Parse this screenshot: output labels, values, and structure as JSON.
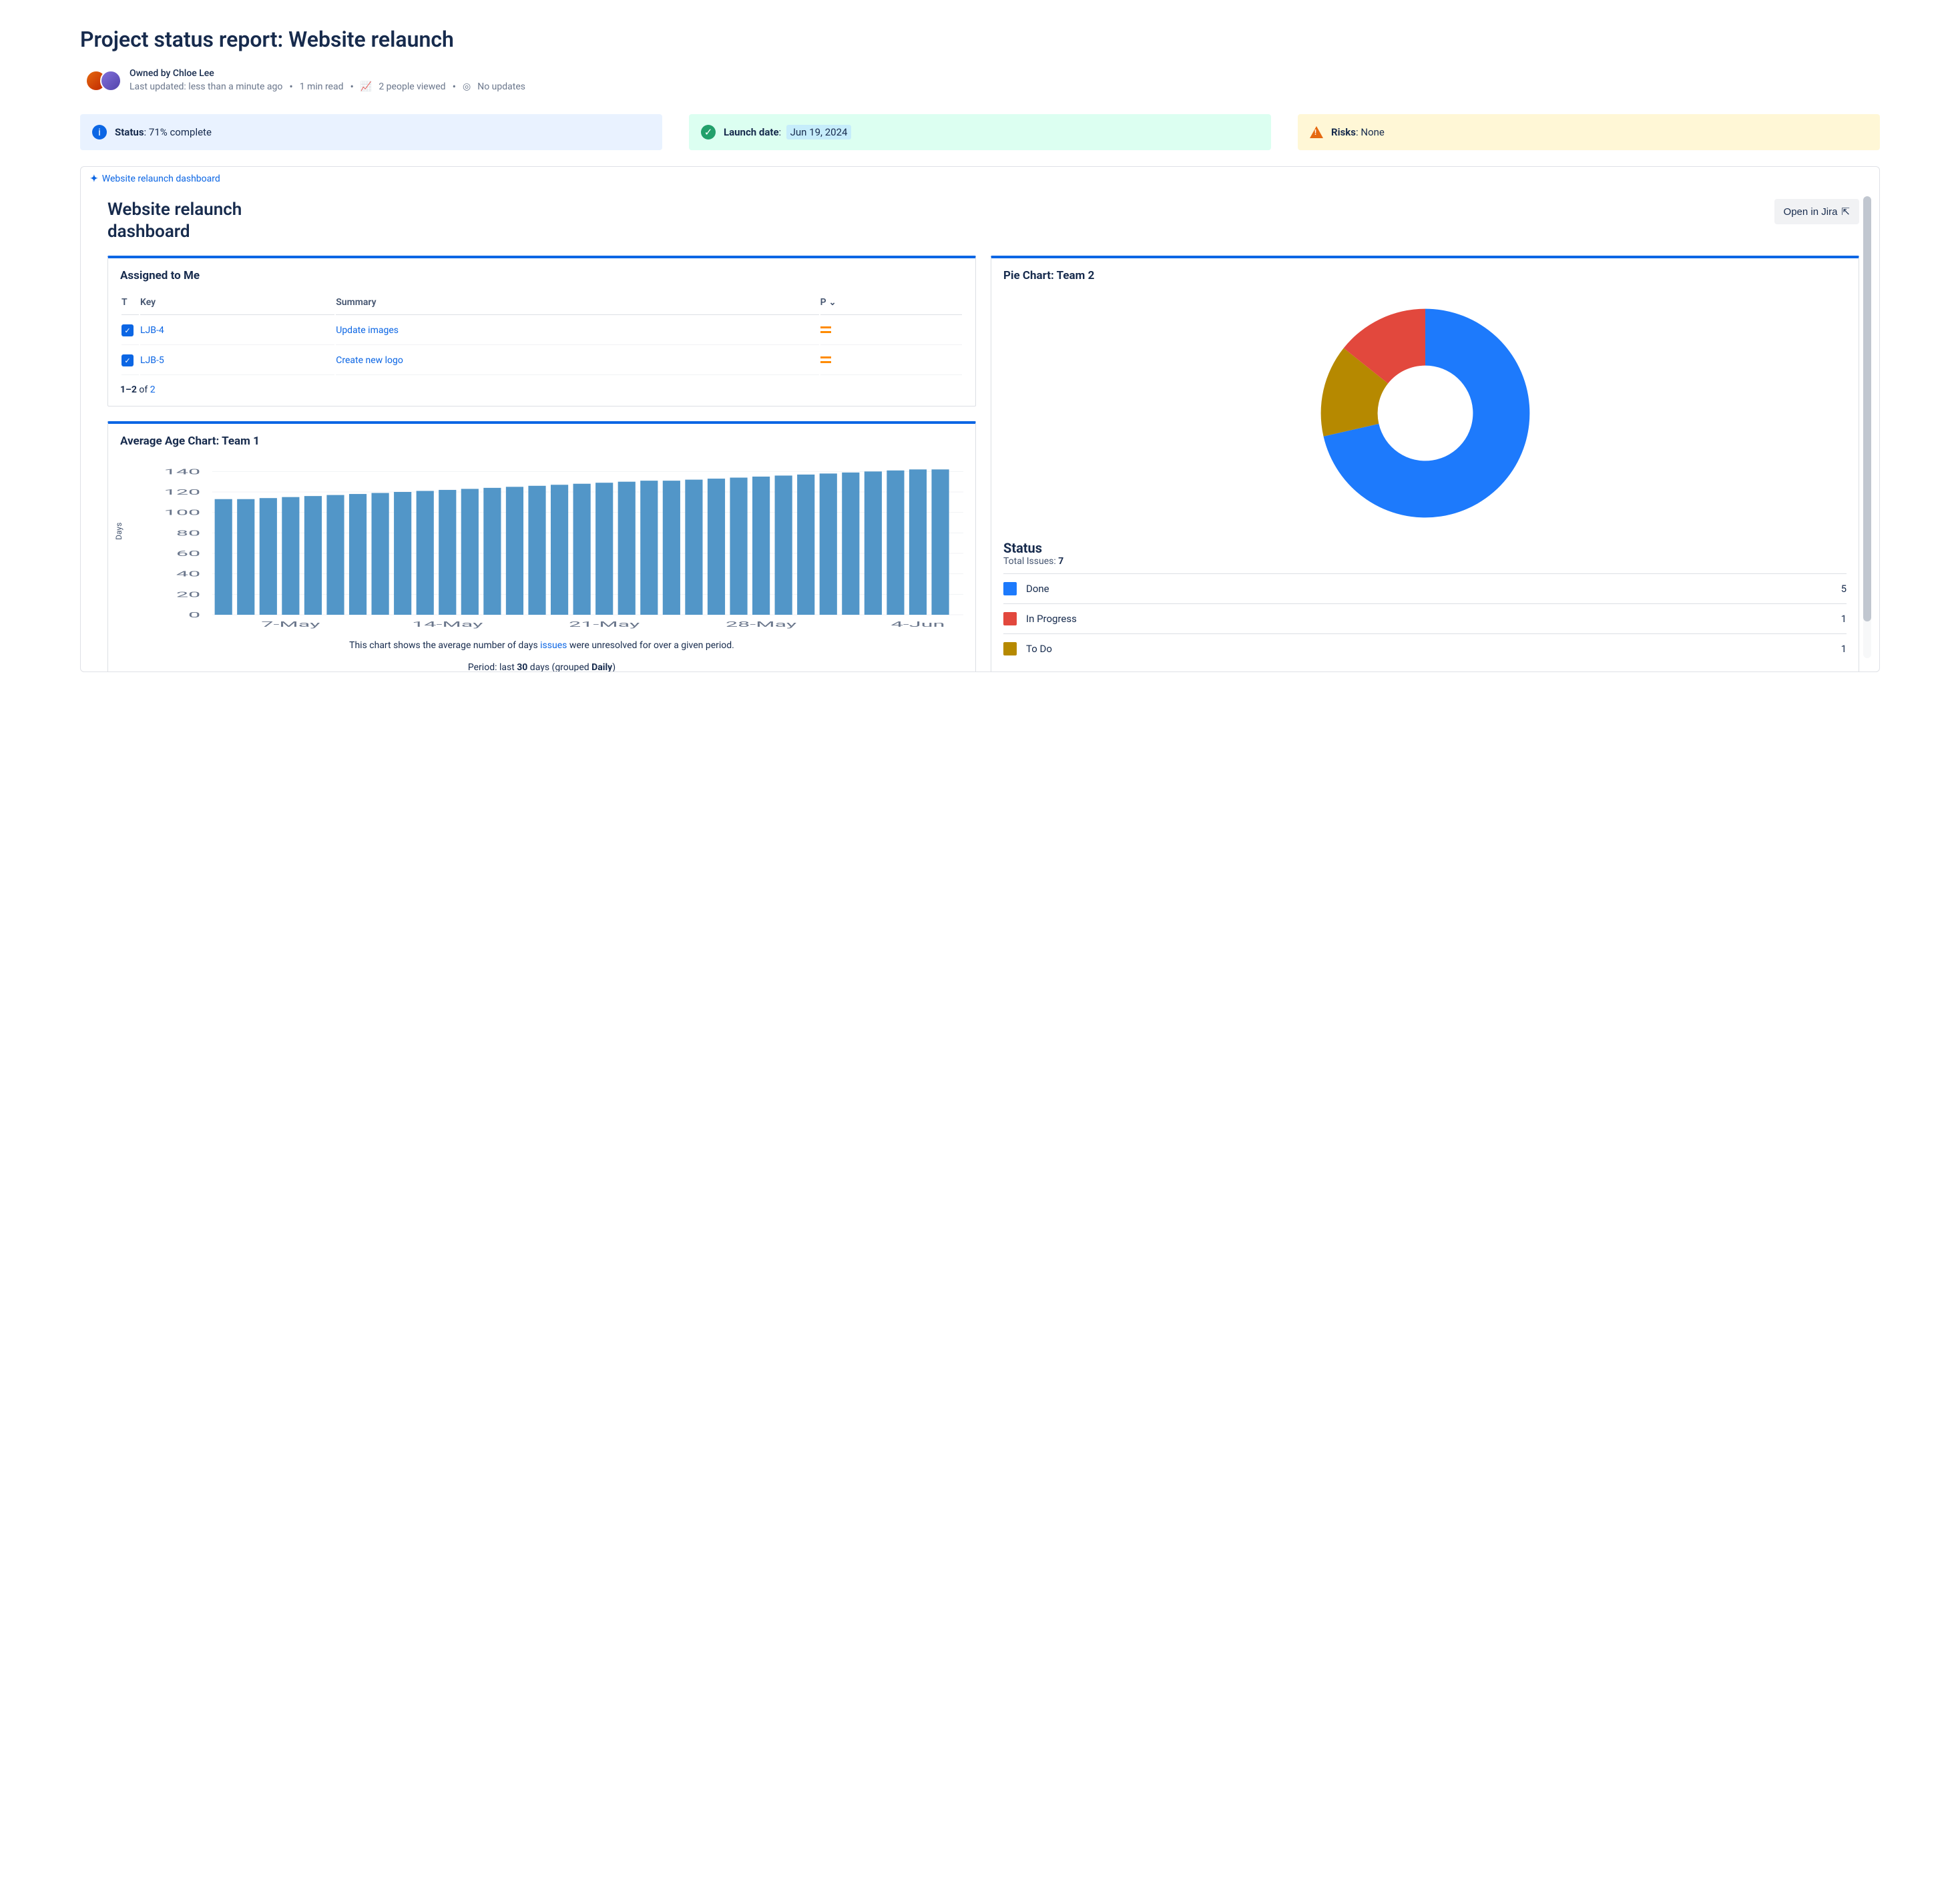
{
  "page": {
    "title": "Project status report: Website relaunch",
    "owner_line": "Owned by Chloe Lee",
    "meta": {
      "last_updated": "Last updated: less than a minute ago",
      "read_time": "1 min read",
      "views": "2 people viewed",
      "updates": "No updates"
    }
  },
  "status_cards": {
    "status": {
      "label": "Status",
      "value": "71% complete"
    },
    "launch": {
      "label": "Launch date",
      "value": "Jun 19, 2024"
    },
    "risks": {
      "label": "Risks",
      "value": "None"
    }
  },
  "dashboard": {
    "link_text": "Website relaunch dashboard",
    "title": "Website relaunch dashboard",
    "open_button": "Open in Jira"
  },
  "assigned": {
    "title": "Assigned to Me",
    "columns": {
      "t": "T",
      "key": "Key",
      "summary": "Summary",
      "p": "P"
    },
    "rows": [
      {
        "key": "LJB-4",
        "summary": "Update images",
        "priority": "medium"
      },
      {
        "key": "LJB-5",
        "summary": "Create new logo",
        "priority": "medium"
      }
    ],
    "pager_prefix": "1–2",
    "pager_of": " of ",
    "pager_total": "2"
  },
  "age_chart": {
    "title": "Average Age Chart: Team 1",
    "y_label": "Days",
    "caption_before": "This chart shows the average number of days ",
    "caption_link": "issues",
    "caption_after": " were unresolved for over a given period.",
    "caption_period_before": "Period: last ",
    "caption_period_bold1": "30",
    "caption_period_mid": " days (grouped ",
    "caption_period_bold2": "Daily",
    "caption_period_after": ")"
  },
  "pie": {
    "title": "Pie Chart: Team 2",
    "status_heading": "Status",
    "total_label": "Total Issues: ",
    "total_value": "7",
    "rows": [
      {
        "label": "Done",
        "count": "5",
        "color": "#1D7AFC"
      },
      {
        "label": "In Progress",
        "count": "1",
        "color": "#E2483D"
      },
      {
        "label": "To Do",
        "count": "1",
        "color": "#B68900"
      }
    ]
  },
  "chart_data": [
    {
      "type": "bar",
      "title": "Average Age Chart: Team 1",
      "ylabel": "Days",
      "ylim": [
        0,
        150
      ],
      "y_ticks": [
        0,
        20,
        40,
        60,
        80,
        100,
        120,
        140
      ],
      "x_tick_labels": [
        "7-May",
        "14-May",
        "21-May",
        "28-May",
        "4-Jun"
      ],
      "categories": [
        "4-May",
        "5-May",
        "6-May",
        "7-May",
        "8-May",
        "9-May",
        "10-May",
        "11-May",
        "12-May",
        "13-May",
        "14-May",
        "15-May",
        "16-May",
        "17-May",
        "18-May",
        "19-May",
        "20-May",
        "21-May",
        "22-May",
        "23-May",
        "24-May",
        "25-May",
        "26-May",
        "27-May",
        "28-May",
        "29-May",
        "30-May",
        "31-May",
        "1-Jun",
        "2-Jun",
        "3-Jun",
        "4-Jun",
        "5-Jun"
      ],
      "values": [
        113,
        113,
        114,
        115,
        116,
        117,
        118,
        119,
        120,
        121,
        122,
        123,
        124,
        125,
        126,
        127,
        128,
        129,
        130,
        131,
        131,
        132,
        133,
        134,
        135,
        136,
        137,
        138,
        139,
        140,
        141,
        142,
        142
      ]
    },
    {
      "type": "pie",
      "title": "Pie Chart: Team 2",
      "series": [
        {
          "name": "Done",
          "value": 5,
          "color": "#1D7AFC"
        },
        {
          "name": "In Progress",
          "value": 1,
          "color": "#E2483D"
        },
        {
          "name": "To Do",
          "value": 1,
          "color": "#B68900"
        }
      ],
      "total": 7
    }
  ]
}
